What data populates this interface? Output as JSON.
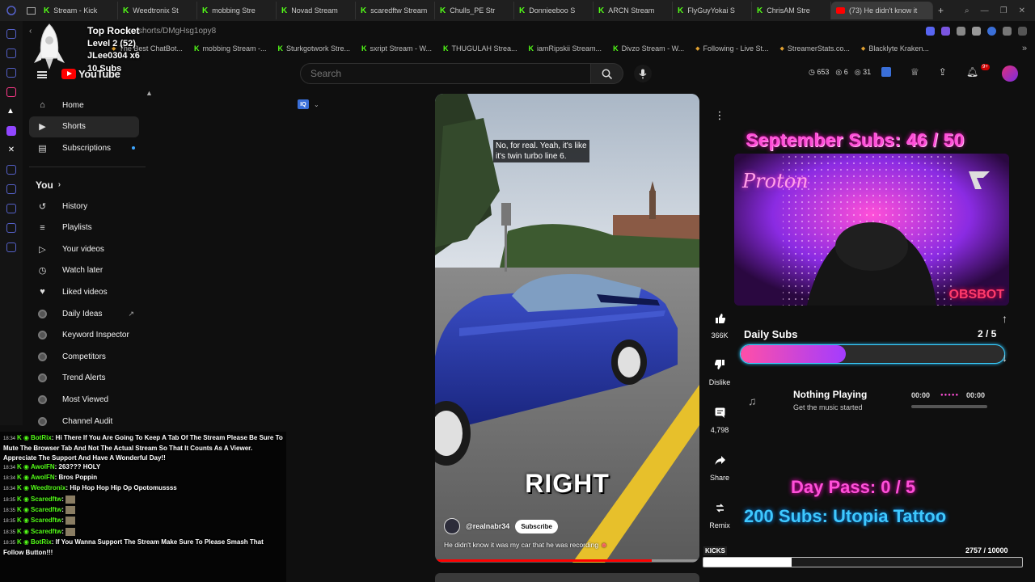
{
  "browser": {
    "tabs": [
      {
        "label": "Stream - Kick",
        "kind": "kick"
      },
      {
        "label": "Weedtronix St",
        "kind": "kick"
      },
      {
        "label": "mobbing Stre",
        "kind": "kick"
      },
      {
        "label": "Novad Stream",
        "kind": "kick"
      },
      {
        "label": "scaredftw Stream",
        "kind": "kick"
      },
      {
        "label": "Chulls_PE Str",
        "kind": "kick"
      },
      {
        "label": "Donnieeboo S",
        "kind": "kick"
      },
      {
        "label": "ARCN Stream",
        "kind": "kick"
      },
      {
        "label": "FlyGuyYokai S",
        "kind": "kick"
      },
      {
        "label": "ChrisAM Stre",
        "kind": "kick"
      },
      {
        "label": "(73) He didn't know it",
        "kind": "youtube",
        "active": true
      }
    ],
    "new_tab": "+",
    "url": "com/shorts/DMgHsg1opy8",
    "bookmarks": [
      {
        "label": "The Best ChatBot...",
        "kind": "plain"
      },
      {
        "label": "mobbing Stream -...",
        "kind": "kick"
      },
      {
        "label": "Sturkgotwork Stre...",
        "kind": "kick"
      },
      {
        "label": "sxript Stream - W...",
        "kind": "kick"
      },
      {
        "label": "THUGULAH Strea...",
        "kind": "kick"
      },
      {
        "label": "iamRipskii Stream...",
        "kind": "kick"
      },
      {
        "label": "Divzo Stream - W...",
        "kind": "kick"
      },
      {
        "label": "Following - Live St...",
        "kind": "plain"
      },
      {
        "label": "StreamerStats.co...",
        "kind": "plain"
      },
      {
        "label": "Blacklyte Kraken...",
        "kind": "plain"
      }
    ]
  },
  "overlay_top": {
    "line1": "Top Rocket",
    "line2": "Level 2  (52)",
    "line3": "JLee0304 x6",
    "line4": "10 Subs"
  },
  "youtube": {
    "logo_text": "YouTube",
    "search_placeholder": "Search",
    "header_stats": [
      "653",
      "6",
      "31"
    ],
    "notifications": "9+",
    "sidebar": {
      "main": [
        {
          "label": "Home",
          "icon": "home-icon"
        },
        {
          "label": "Shorts",
          "icon": "shorts-icon",
          "active": true
        },
        {
          "label": "Subscriptions",
          "icon": "subscriptions-icon"
        }
      ],
      "you_heading": "You",
      "you_items": [
        {
          "label": "History",
          "icon": "history-icon"
        },
        {
          "label": "Playlists",
          "icon": "playlists-icon"
        },
        {
          "label": "Your videos",
          "icon": "your-videos-icon"
        },
        {
          "label": "Watch later",
          "icon": "watch-later-icon"
        },
        {
          "label": "Liked videos",
          "icon": "liked-videos-icon"
        }
      ],
      "tools": [
        {
          "label": "Daily Ideas",
          "external": true
        },
        {
          "label": "Keyword Inspector"
        },
        {
          "label": "Competitors"
        },
        {
          "label": "Trend Alerts"
        },
        {
          "label": "Most Viewed"
        },
        {
          "label": "Channel Audit"
        }
      ]
    },
    "short": {
      "caption_top": "No, for real. Yeah, it's like\nit's twin turbo line 6.",
      "caption_big": "RIGHT",
      "channel": "@realnabr34",
      "subscribe": "Subscribe",
      "description": "He didn't know it was my car that he was recording",
      "progress": 0.82
    },
    "actions": {
      "likes": "366K",
      "dislike": "Dislike",
      "comments": "4,798",
      "share": "Share",
      "remix": "Remix"
    }
  },
  "chat": [
    {
      "time": "18:34",
      "user": "BotRix",
      "text": "Hi There If You Are Going To Keep A Tab Of The Stream Please Be Sure To Mute The Browser Tab And Not The Actual Stream So That It Counts As A Viewer. Appreciate The Support And Have A Wonderful Day!!"
    },
    {
      "time": "18:34",
      "user": "AwolFN",
      "text": "263??? HOLY"
    },
    {
      "time": "18:34",
      "user": "AwolFN",
      "text": "Bros Poppin"
    },
    {
      "time": "18:34",
      "user": "Weedtronix",
      "text": "Hip Hop Hop Hip Op Opotomussss"
    },
    {
      "time": "18:35",
      "user": "Scaredftw",
      "text": "",
      "emote": true
    },
    {
      "time": "18:35",
      "user": "Scaredftw",
      "text": "",
      "emote": true
    },
    {
      "time": "18:35",
      "user": "Scaredftw",
      "text": "",
      "emote": true
    },
    {
      "time": "18:35",
      "user": "Scaredftw",
      "text": "",
      "emote": true
    },
    {
      "time": "18:35",
      "user": "BotRix",
      "text": "If You Wanna Support The Stream Make Sure To Please Smash That Follow Button!!!"
    }
  ],
  "stream_overlay": {
    "sept_subs": "September Subs: 46 / 50",
    "cam_brand": "Proton",
    "cam_watermark": "OBSBOT",
    "daily_subs_label": "Daily Subs",
    "daily_subs_count": "2 / 5",
    "daily_subs_progress": 0.4,
    "music_title": "Nothing Playing",
    "music_sub": "Get the music started",
    "music_time_start": "00:00",
    "music_time_end": "00:00",
    "day_pass": "Day Pass: 0 / 5",
    "goal_200": "200 Subs: Utopia Tattoo",
    "kicks_label": "KICKS",
    "kicks_count": "2757 / 10000",
    "kicks_progress": 0.2757
  },
  "colors": {
    "kick_green": "#53fc18",
    "youtube_red": "#ff0000",
    "neon_pink": "#ff4fd8",
    "neon_blue": "#3ec8ff"
  }
}
